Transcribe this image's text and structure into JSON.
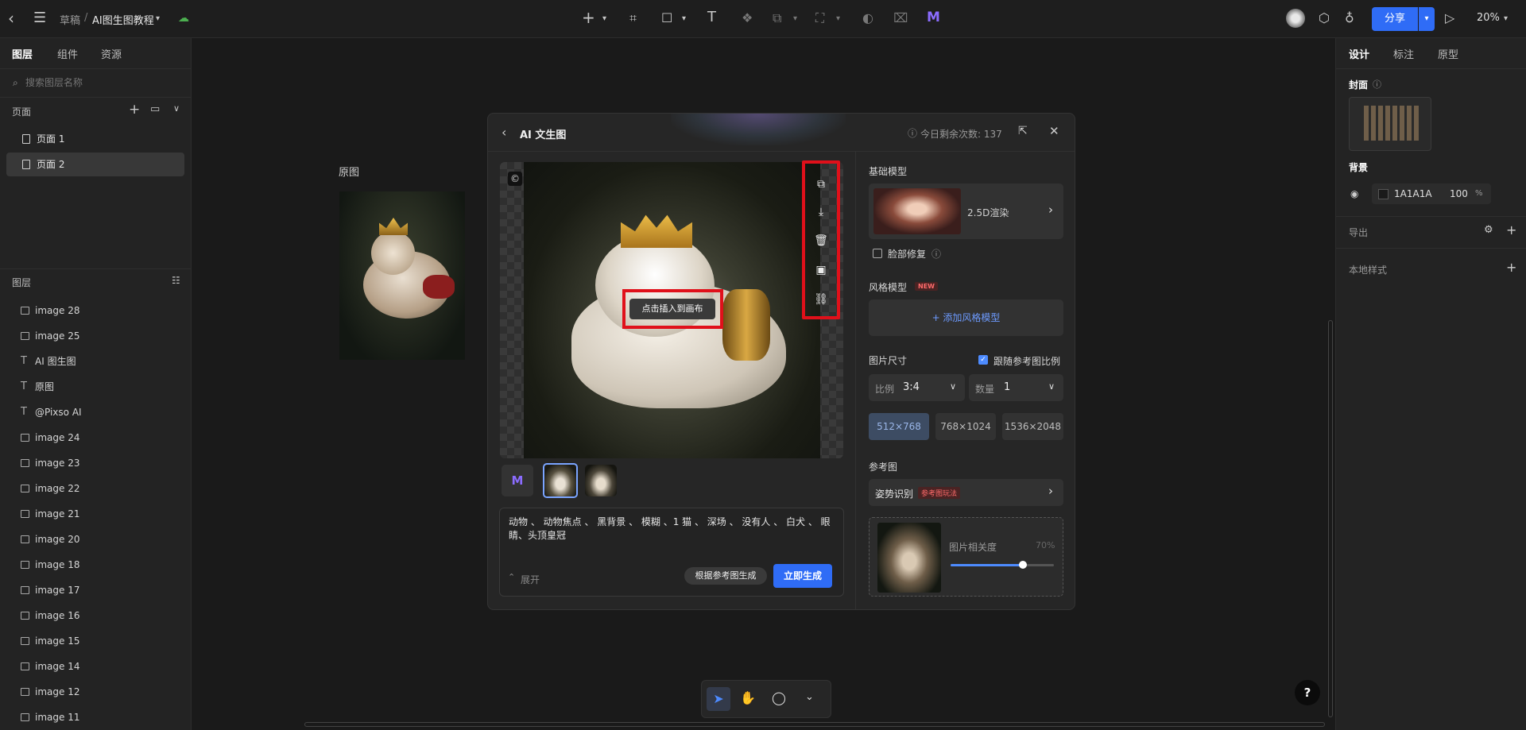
{
  "topbar": {
    "breadcrumb_parent": "草稿",
    "breadcrumb_sep": "/",
    "file_name": "AI图生图教程",
    "share_label": "分享",
    "zoom": "20%"
  },
  "left_panel": {
    "tabs": [
      "图层",
      "组件",
      "资源"
    ],
    "search_placeholder": "搜索图层名称",
    "pages_title": "页面",
    "pages": [
      "页面 1",
      "页面 2"
    ],
    "layers_title": "图层",
    "layers": [
      {
        "name": "image 28",
        "kind": "image"
      },
      {
        "name": "image 25",
        "kind": "image"
      },
      {
        "name": "AI 图生图",
        "kind": "text"
      },
      {
        "name": "原图",
        "kind": "text"
      },
      {
        "name": "@Pixso AI",
        "kind": "text"
      },
      {
        "name": "image 24",
        "kind": "image"
      },
      {
        "name": "image 23",
        "kind": "image"
      },
      {
        "name": "image 22",
        "kind": "image"
      },
      {
        "name": "image 21",
        "kind": "image"
      },
      {
        "name": "image 20",
        "kind": "image"
      },
      {
        "name": "image 18",
        "kind": "image"
      },
      {
        "name": "image 17",
        "kind": "image"
      },
      {
        "name": "image 16",
        "kind": "image"
      },
      {
        "name": "image 15",
        "kind": "image"
      },
      {
        "name": "image 14",
        "kind": "image"
      },
      {
        "name": "image 12",
        "kind": "image"
      },
      {
        "name": "image 11",
        "kind": "image"
      }
    ]
  },
  "canvas": {
    "original_label": "原图"
  },
  "dialog": {
    "title": "AI 文生图",
    "remaining": "今日剩余次数: 137",
    "insert_label": "点击插入到画布",
    "prompt_text": "动物 、 动物焦点 、 黑背景 、 模糊 、1 猫 、 深场 、 没有人 、 白犬 、 眼睛、头顶皇冠",
    "expand_label": "展开",
    "ref_generate_label": "根据参考图生成",
    "generate_label": "立即生成",
    "base_model_title": "基础模型",
    "base_model_name": "2.5D渲染",
    "face_fix_label": "脸部修复",
    "style_model_title": "风格模型",
    "new_badge": "NEW",
    "add_style_label": "+ 添加风格模型",
    "size_title": "图片尺寸",
    "follow_ratio_label": "跟随参考图比例",
    "ratio_label": "比例",
    "ratio_value": "3:4",
    "count_label": "数量",
    "count_value": "1",
    "sizes": [
      "512×768",
      "768×1024",
      "1536×2048"
    ],
    "ref_title": "参考图",
    "pose_label": "姿势识别",
    "pose_badge": "参考图玩法",
    "similarity_label": "图片相关度",
    "similarity_value": "70%",
    "similarity": 0.7
  },
  "right_panel": {
    "tabs": [
      "设计",
      "标注",
      "原型"
    ],
    "cover_title": "封面",
    "background_title": "背景",
    "bg_hex": "1A1A1A",
    "bg_opacity": "100",
    "bg_percent": "%",
    "export_title": "导出",
    "local_styles_title": "本地样式"
  },
  "colors": {
    "accent": "#2f6cf6",
    "highlight": "#e0101a"
  }
}
